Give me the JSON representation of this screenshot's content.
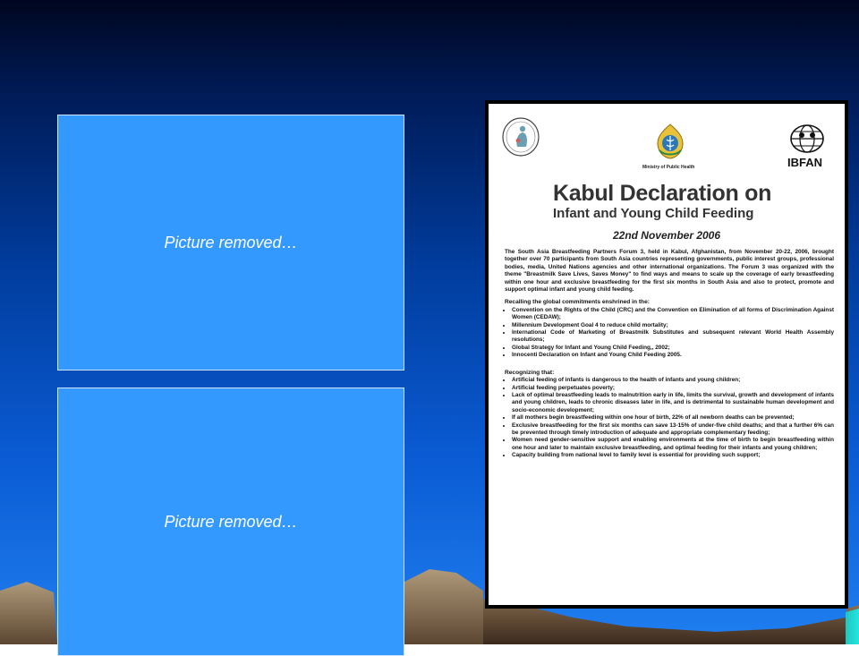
{
  "placeholders": {
    "top": "Picture removed…",
    "bottom": "Picture removed…"
  },
  "doc": {
    "ministry": "Ministry of Public Health",
    "ibfan": "IBFAN",
    "title_line1": "Kabul Declaration on",
    "title_line2": "Infant and Young Child Feeding",
    "date": "22nd November 2006",
    "intro": "The South Asia Breastfeeding Partners Forum 3, held in Kabul, Afghanistan, from November 20-22, 2006, brought together over 70 participants from South Asia countries representing governments, public interest groups, professional bodies, media, United Nations agencies and other international organizations. The Forum 3 was organized with the theme \"Breastmilk Save Lives, Saves Money\" to find ways and means to scale up the coverage of early breastfeeding within one hour and exclusive breastfeeding for the first six months in South Asia and also to protect, promote and support optimal infant and young child feeding.",
    "recalling_heading": "Recalling the global commitments enshrined in the:",
    "recalling": [
      "Convention on the Rights of the Child (CRC) and the Convention on Elimination of all forms of Discrimination Against Women (CEDAW);",
      "Millennium Development Goal 4 to reduce child mortality;",
      "International Code of Marketing of Breastmilk Substitutes and subsequent relevant World Health Assembly resolutions;",
      "Global Strategy for Infant and Young Child Feeding,, 2002;",
      "Innocenti Declaration on Infant and Young Child Feeding 2005."
    ],
    "recognizing_heading": "Recognizing that:",
    "recognizing": [
      "Artificial feeding of infants is dangerous to the health of infants and young children;",
      "Artificial feeding perpetuates poverty;",
      "Lack of optimal breastfeeding leads to malnutrition early in life, limits the survival, growth and development of infants and young children, leads to chronic diseases later in life, and is detrimental to sustainable human development and socio-economic development;",
      "If all mothers begin breastfeeding within one hour of birth, 22% of all newborn deaths can be prevented;",
      "Exclusive breastfeeding for the first six months can save 13-15% of under-five child deaths; and that a further 6% can be prevented through timely introduction of adequate and appropriate complementary feeding;",
      "Women need gender-sensitive support and enabling environments at the time of birth to begin breastfeeding within one hour and later to maintain exclusive breastfeeding, and optimal feeding for their infants and young children;",
      "Capacity building from national level to family level is essential for providing such support;"
    ]
  }
}
